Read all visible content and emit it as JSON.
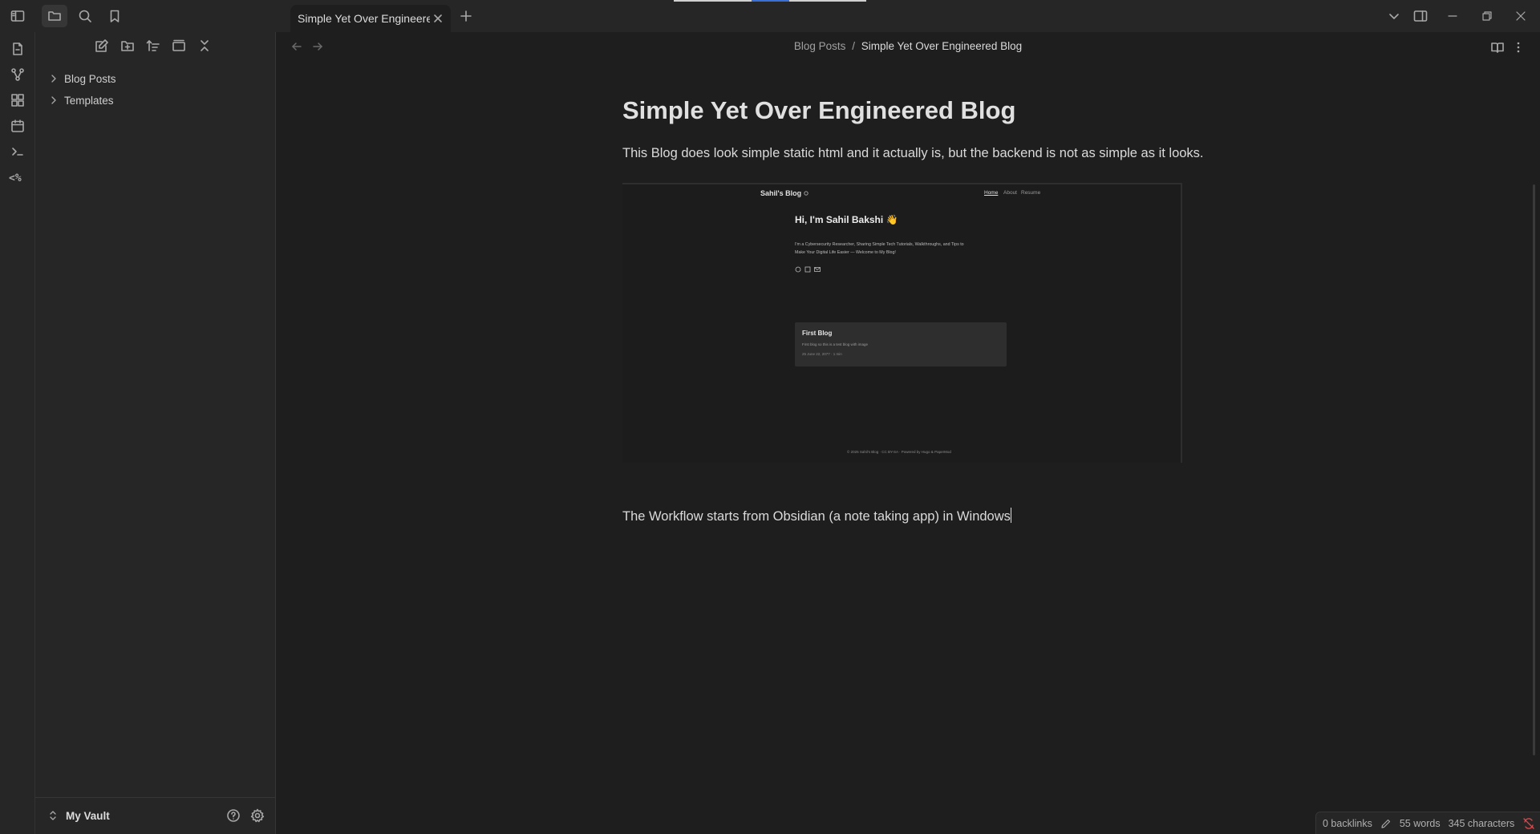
{
  "tab": {
    "title": "Simple Yet Over Engineere..."
  },
  "sidebar": {
    "items": [
      {
        "label": "Blog Posts"
      },
      {
        "label": "Templates"
      }
    ],
    "vault_name": "My Vault"
  },
  "note": {
    "breadcrumb_folder": "Blog Posts",
    "breadcrumb_separator": "/",
    "breadcrumb_current": "Simple Yet Over Engineered Blog",
    "title": "Simple Yet Over Engineered Blog",
    "paragraph1": "This Blog does look simple static html and it actually is, but the backend is not as simple as it looks.",
    "paragraph2": "The Workflow starts from Obsidian (a note taking app) in Windows"
  },
  "embed": {
    "site_title": "Sahil's Blog",
    "nav": [
      "Home",
      "About",
      "Resume"
    ],
    "heading": "Hi, I'm Sahil Bakshi 👋",
    "intro_line1": "I'm a Cybersecurity Researcher, Sharing Simple Tech Tutorials, Walkthroughs, and Tips to",
    "intro_line2": "Make Your Digital Life Easier — Welcome to My Blog!",
    "card_title": "First Blog",
    "card_desc": "First blog so this is a test blog with image",
    "card_meta": "25 June 22, 2077 · 1 min",
    "footer": "© 2025 Sahil's Blog · CC BY-SA · Powered by Hugo & PaperMod"
  },
  "status": {
    "backlinks": "0 backlinks",
    "words": "55 words",
    "characters": "345 characters"
  },
  "colors": {
    "background": "#1e1e1e",
    "panel": "#262626",
    "sync_error": "#e5484d"
  }
}
